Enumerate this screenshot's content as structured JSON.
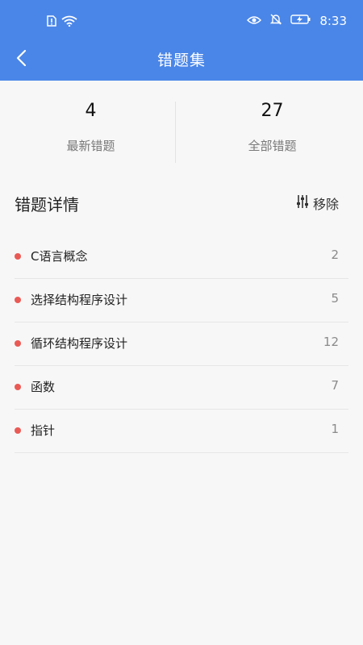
{
  "status_bar": {
    "time": "8:33",
    "icons": [
      "sim-alert-icon",
      "wifi-icon",
      "eye-icon",
      "bell-off-icon",
      "battery-charging-icon"
    ]
  },
  "nav": {
    "title": "错题集",
    "back_icon": "chevron-left-icon"
  },
  "stats": [
    {
      "value": "4",
      "label": "最新错题"
    },
    {
      "value": "27",
      "label": "全部错题"
    }
  ],
  "section": {
    "title": "错题详情",
    "remove_label": "移除",
    "remove_icon": "sliders-icon"
  },
  "items": [
    {
      "label": "C语言概念",
      "count": "2"
    },
    {
      "label": "选择结构程序设计",
      "count": "5"
    },
    {
      "label": "循环结构程序设计",
      "count": "12"
    },
    {
      "label": "函数",
      "count": "7"
    },
    {
      "label": "指针",
      "count": "1"
    }
  ],
  "colors": {
    "header": "#4a86e8",
    "dot": "#ea5a55",
    "background": "#f7f7f7"
  }
}
